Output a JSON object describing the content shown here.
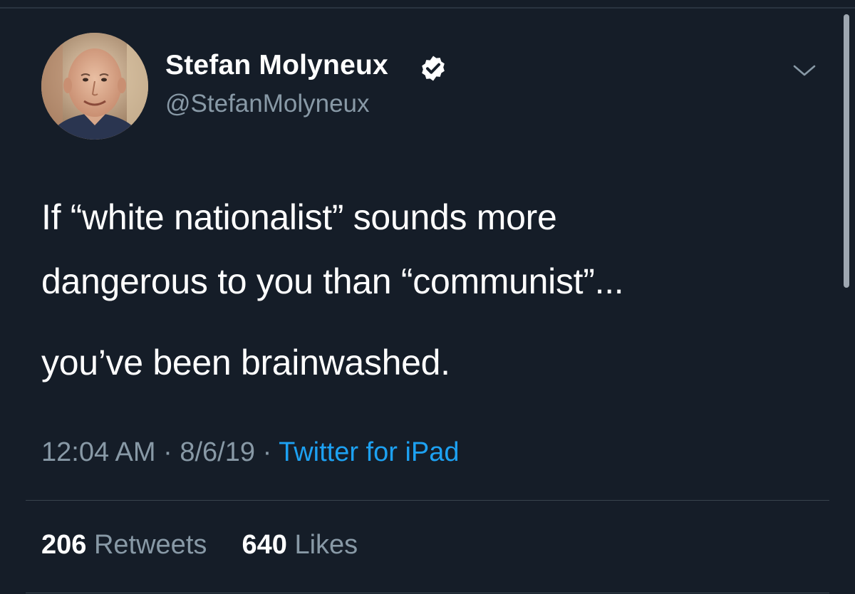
{
  "tweet": {
    "author": {
      "display_name": "Stefan Molyneux",
      "handle": "@StefanMolyneux",
      "verified": true
    },
    "text_lines": [
      "If “white nationalist” sounds more",
      "dangerous to you than “communist”...",
      "you’ve been brainwashed."
    ],
    "meta": {
      "time": "12:04 AM",
      "separator": "·",
      "date": "8/6/19",
      "source": "Twitter for iPad"
    },
    "stats": {
      "retweets_count": "206",
      "retweets_label": "Retweets",
      "likes_count": "640",
      "likes_label": "Likes"
    }
  },
  "icons": {
    "verified": "verified-badge-icon",
    "menu": "chevron-down-icon"
  },
  "colors": {
    "background": "#151d28",
    "secondary_text": "#8899a6",
    "link": "#1da1f2",
    "primary_text": "#ffffff"
  }
}
